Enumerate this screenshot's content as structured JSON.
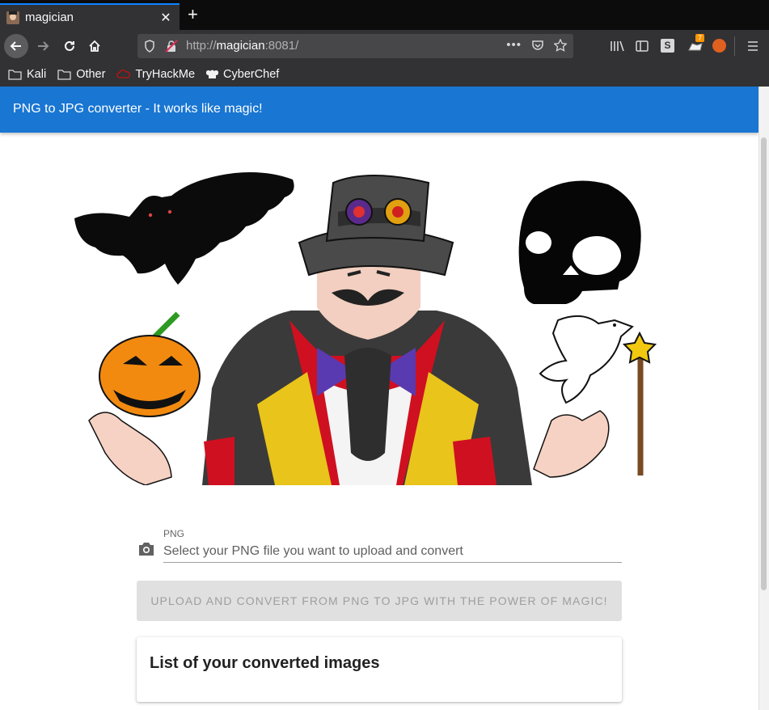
{
  "browser": {
    "tab_title": "magician",
    "url_host": "magician",
    "url_prefix": "http://",
    "url_suffix": ":8081/",
    "bookmarks": [
      "Kali",
      "Other",
      "TryHackMe",
      "CyberChef"
    ],
    "notification_count": "7"
  },
  "app": {
    "header_title": "PNG to JPG converter - It works like magic!",
    "field_label": "PNG",
    "field_placeholder": "Select your PNG file you want to upload and convert",
    "upload_label": "UPLOAD AND CONVERT FROM PNG TO JPG WITH THE POWER OF MAGIC!",
    "list_title": "List of your converted images"
  },
  "colors": {
    "header": "#1976d2",
    "tab_accent": "#0a84ff"
  }
}
